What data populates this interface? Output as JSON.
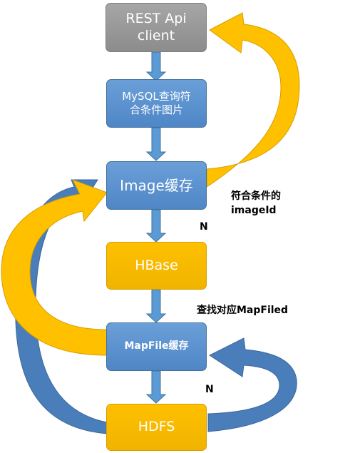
{
  "nodes": {
    "rest_client": "REST Api\nclient",
    "mysql_query": "MySQL查询符\n合条件图片",
    "image_cache": "Image缓存",
    "hbase": "HBase",
    "mapfile_cache": "MapFile缓存",
    "hdfs": "HDFS"
  },
  "labels": {
    "matching_image_id": "符合条件的\nimageId",
    "n_after_image_cache": "N",
    "find_mapfiled": "查找对应MapFiled",
    "n_after_mapfile_cache": "N"
  },
  "colors": {
    "client": "#8c8c8c",
    "process": "#5b9bd5",
    "storage": "#ffc000",
    "loop_blue": "#4a7ebb",
    "loop_gold": "#ffc000"
  }
}
